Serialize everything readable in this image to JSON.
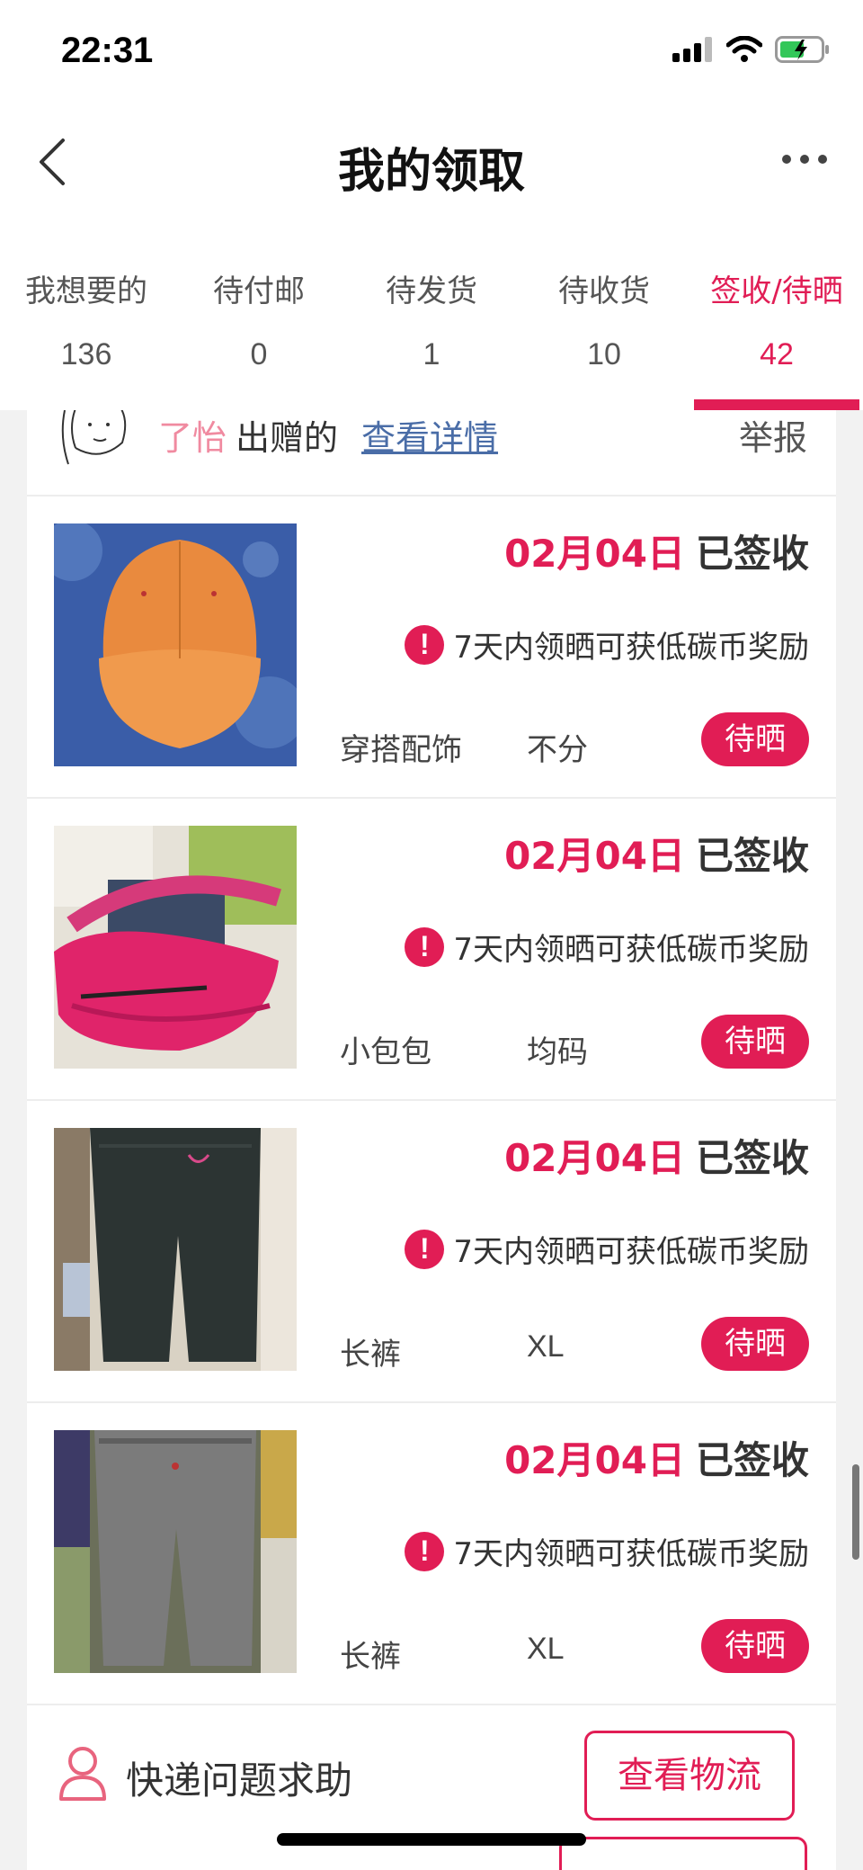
{
  "status_bar": {
    "time": "22:31"
  },
  "nav": {
    "title": "我的领取"
  },
  "tabs": [
    {
      "label": "我想要的",
      "count": "136"
    },
    {
      "label": "待付邮",
      "count": "0"
    },
    {
      "label": "待发货",
      "count": "1"
    },
    {
      "label": "待收货",
      "count": "10"
    },
    {
      "label": "签收/待晒",
      "count": "42",
      "active": true
    }
  ],
  "giver": {
    "name": "了怡",
    "text": "出赠的",
    "link": "查看详情",
    "report": "举报"
  },
  "items": [
    {
      "date": "02月04日",
      "state": "已签收",
      "notice": "7天内领晒可获低碳币奖励",
      "category": "穿搭配饰",
      "size": "不分",
      "button": "待晒",
      "image": "orange-cap"
    },
    {
      "date": "02月04日",
      "state": "已签收",
      "notice": "7天内领晒可获低碳币奖励",
      "category": "小包包",
      "size": "均码",
      "button": "待晒",
      "image": "pink-bag"
    },
    {
      "date": "02月04日",
      "state": "已签收",
      "notice": "7天内领晒可获低碳币奖励",
      "category": "长裤",
      "size": "XL",
      "button": "待晒",
      "image": "dark-pants"
    },
    {
      "date": "02月04日",
      "state": "已签收",
      "notice": "7天内领晒可获低碳币奖励",
      "category": "长裤",
      "size": "XL",
      "button": "待晒",
      "image": "grey-pants"
    }
  ],
  "help": {
    "text": "快递问题求助",
    "button": "查看物流"
  },
  "icons": {
    "back": "chevron-left-icon",
    "more": "more-dots-icon",
    "notice": "exclamation-icon",
    "help": "user-icon"
  },
  "colors": {
    "accent": "#e11d55"
  }
}
